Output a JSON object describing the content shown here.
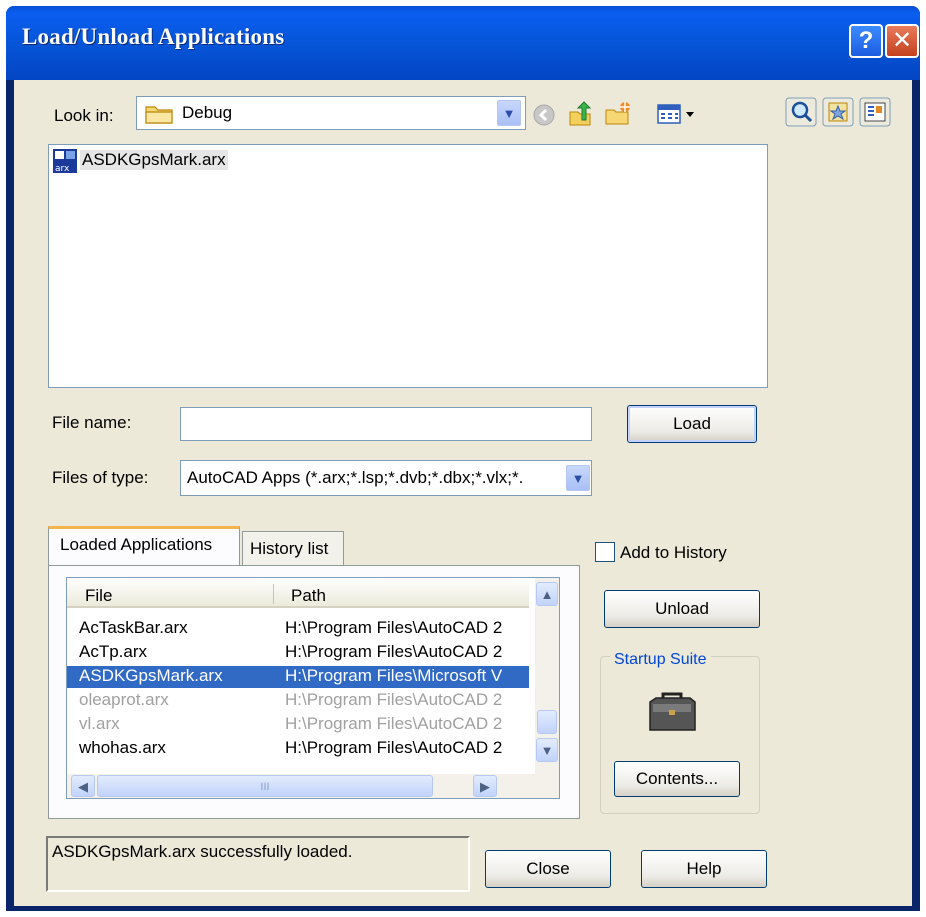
{
  "window": {
    "title": "Load/Unload Applications",
    "help_glyph": "?",
    "close_glyph": "✕"
  },
  "lookin": {
    "label": "Look in:",
    "value": "Debug"
  },
  "files": [
    {
      "name": "ASDKGpsMark.arx",
      "icon": "arx-file-icon"
    }
  ],
  "filename": {
    "label": "File name:",
    "value": ""
  },
  "filetype": {
    "label": "Files of type:",
    "value": "AutoCAD Apps (*.arx;*.lsp;*.dvb;*.dbx;*.vlx;*."
  },
  "buttons": {
    "load": "Load",
    "unload": "Unload",
    "contents": "Contents...",
    "close": "Close",
    "help": "Help"
  },
  "tabs": [
    "Loaded Applications",
    "History list"
  ],
  "add_to_history": {
    "label": "Add to History",
    "checked": false
  },
  "startup_suite": {
    "label": "Startup Suite",
    "icon": "briefcase-icon"
  },
  "table": {
    "headers": [
      "File",
      "Path"
    ],
    "rows": [
      {
        "file": "AcTaskBar.arx",
        "path": "H:\\Program Files\\AutoCAD 2",
        "state": "normal"
      },
      {
        "file": "AcTp.arx",
        "path": "H:\\Program Files\\AutoCAD 2",
        "state": "normal"
      },
      {
        "file": "ASDKGpsMark.arx",
        "path": "H:\\Program Files\\Microsoft V",
        "state": "selected"
      },
      {
        "file": "oleaprot.arx",
        "path": "H:\\Program Files\\AutoCAD 2",
        "state": "disabled"
      },
      {
        "file": "vl.arx",
        "path": "H:\\Program Files\\AutoCAD 2",
        "state": "disabled"
      },
      {
        "file": "whohas.arx",
        "path": "H:\\Program Files\\AutoCAD 2",
        "state": "normal"
      }
    ],
    "hscroll_thumb_glyph": "III"
  },
  "status": "ASDKGpsMark.arx successfully loaded.",
  "colors": {
    "titlebar": "#0654d6",
    "selection": "#316ac5",
    "tab_accent": "#f3b54a",
    "dialog_bg": "#ece9d8"
  }
}
